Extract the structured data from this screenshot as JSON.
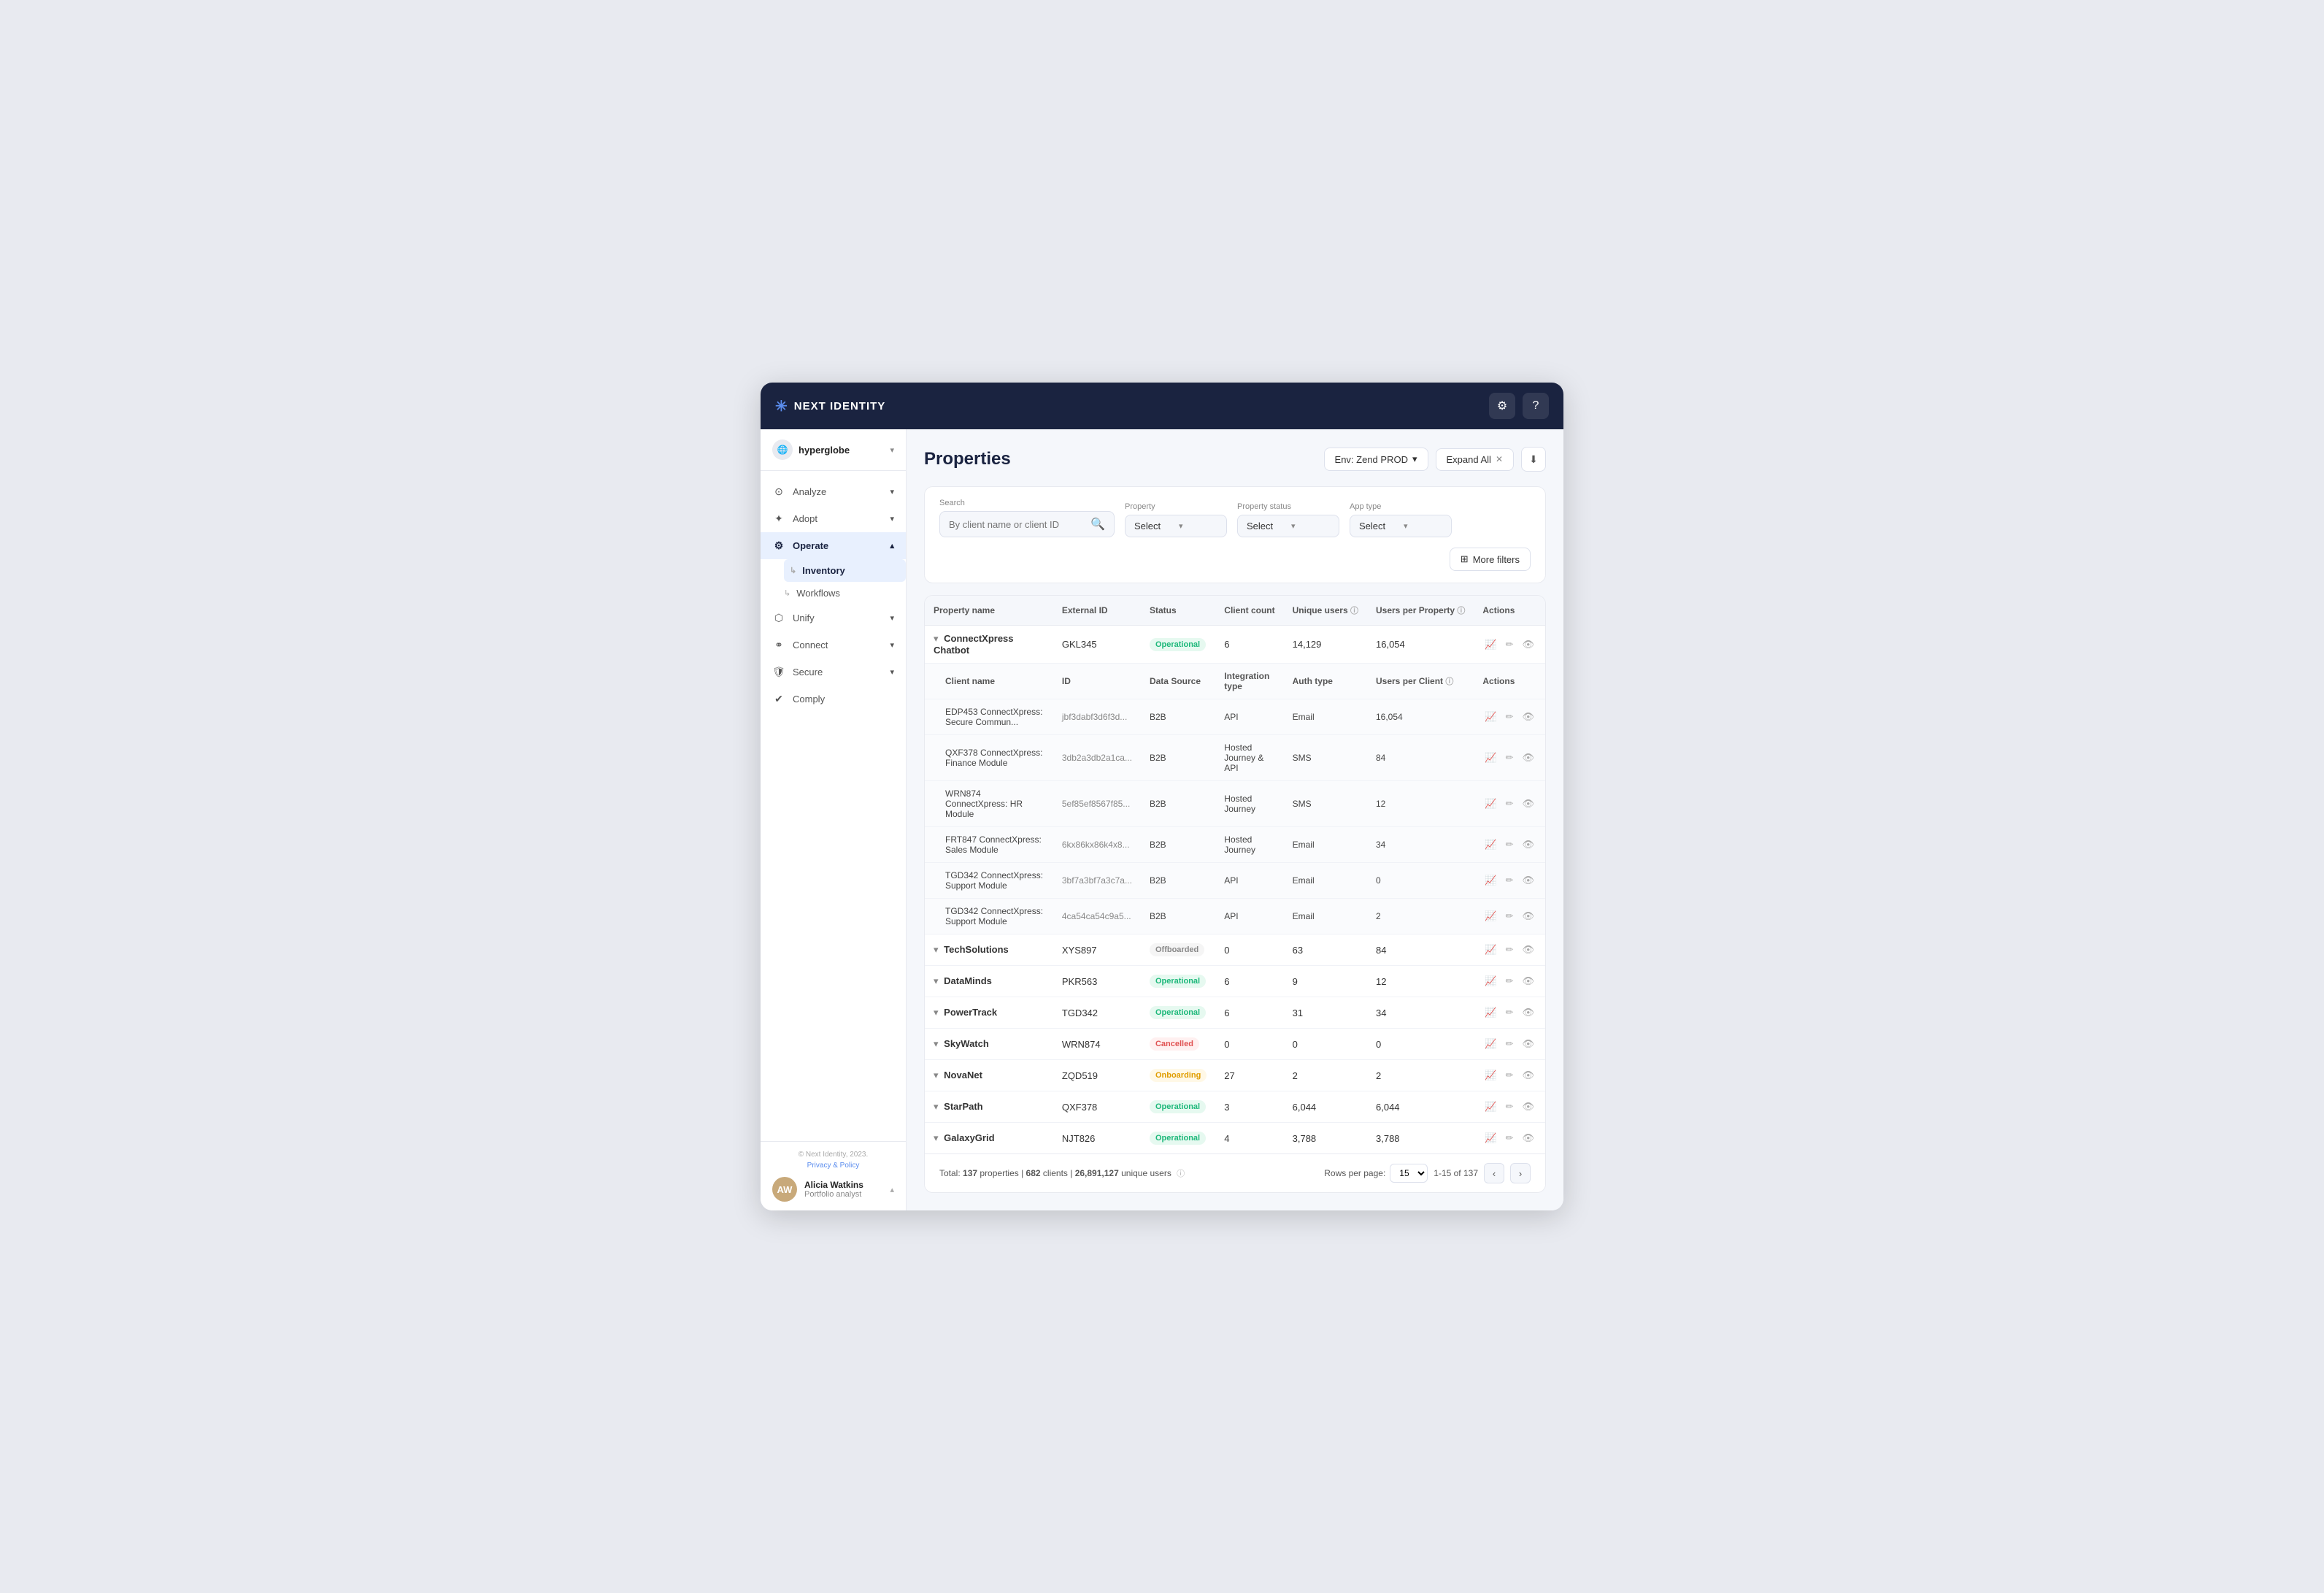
{
  "app": {
    "name": "NEXT IDENTITY",
    "logo_star": "✳"
  },
  "topbar": {
    "settings_label": "Settings",
    "help_label": "Help"
  },
  "sidebar": {
    "org_name": "hyperglobe",
    "nav_items": [
      {
        "id": "analyze",
        "label": "Analyze",
        "icon": "⊙",
        "has_arrow": true
      },
      {
        "id": "adopt",
        "label": "Adopt",
        "icon": "✦",
        "has_arrow": true
      },
      {
        "id": "operate",
        "label": "Operate",
        "icon": "⚙",
        "has_arrow": true,
        "active": true,
        "children": [
          {
            "id": "inventory",
            "label": "Inventory",
            "active": true
          },
          {
            "id": "workflows",
            "label": "Workflows"
          }
        ]
      },
      {
        "id": "unify",
        "label": "Unify",
        "icon": "⬡",
        "has_arrow": true
      },
      {
        "id": "connect",
        "label": "Connect",
        "icon": "⚭",
        "has_arrow": true
      },
      {
        "id": "secure",
        "label": "Secure",
        "icon": "⛨",
        "has_arrow": true
      },
      {
        "id": "comply",
        "label": "Comply",
        "icon": "✔",
        "has_arrow": false
      }
    ],
    "footer": {
      "copy": "© Next Identity, 2023.",
      "privacy": "Privacy & Policy"
    },
    "user": {
      "name": "Alicia Watkins",
      "role": "Portfolio analyst",
      "initials": "AW"
    }
  },
  "page": {
    "title": "Properties",
    "env_label": "Env: Zend PROD",
    "expand_label": "Expand All",
    "export_icon": "⬇"
  },
  "filters": {
    "search_label": "Search",
    "search_placeholder": "By client name or client ID",
    "property_label": "Property",
    "property_placeholder": "Select",
    "status_label": "Property status",
    "status_placeholder": "Select",
    "apptype_label": "App type",
    "apptype_placeholder": "Select",
    "more_filters_label": "More filters",
    "filter_icon": "⊞"
  },
  "table": {
    "headers": [
      {
        "id": "name",
        "label": "Property name"
      },
      {
        "id": "ext_id",
        "label": "External ID"
      },
      {
        "id": "status",
        "label": "Status"
      },
      {
        "id": "client_count",
        "label": "Client count"
      },
      {
        "id": "unique_users",
        "label": "Unique users"
      },
      {
        "id": "users_per_property",
        "label": "Users per Property"
      },
      {
        "id": "actions",
        "label": "Actions"
      }
    ],
    "sub_headers": [
      {
        "id": "client_name",
        "label": "Client name"
      },
      {
        "id": "id",
        "label": "ID"
      },
      {
        "id": "data_source",
        "label": "Data Source"
      },
      {
        "id": "integration_type",
        "label": "Integration type"
      },
      {
        "id": "auth_type",
        "label": "Auth type"
      },
      {
        "id": "users_per_client",
        "label": "Users per Client"
      },
      {
        "id": "sub_actions",
        "label": "Actions"
      }
    ],
    "rows": [
      {
        "id": "connectxpress",
        "name": "ConnectXpress Chatbot",
        "ext_id": "GKL345",
        "status": "Operational",
        "status_class": "status-operational",
        "client_count": "6",
        "unique_users": "14,129",
        "users_per_property": "16,054",
        "expanded": true,
        "children": [
          {
            "client_name": "EDP453 ConnectXpress: Secure Commun...",
            "id": "jbf3dabf3d6f3d...",
            "data_source": "B2B",
            "integration_type": "API",
            "auth_type": "Email",
            "users_per_client": "16,054"
          },
          {
            "client_name": "QXF378 ConnectXpress: Finance Module",
            "id": "3db2a3db2a1ca...",
            "data_source": "B2B",
            "integration_type": "Hosted Journey & API",
            "auth_type": "SMS",
            "users_per_client": "84"
          },
          {
            "client_name": "WRN874 ConnectXpress: HR Module",
            "id": "5ef85ef8567f85...",
            "data_source": "B2B",
            "integration_type": "Hosted Journey",
            "auth_type": "SMS",
            "users_per_client": "12"
          },
          {
            "client_name": "FRT847 ConnectXpress: Sales Module",
            "id": "6kx86kx86k4x8...",
            "data_source": "B2B",
            "integration_type": "Hosted Journey",
            "auth_type": "Email",
            "users_per_client": "34"
          },
          {
            "client_name": "TGD342 ConnectXpress: Support Module",
            "id": "3bf7a3bf7a3c7a...",
            "data_source": "B2B",
            "integration_type": "API",
            "auth_type": "Email",
            "users_per_client": "0"
          },
          {
            "client_name": "TGD342 ConnectXpress: Support Module",
            "id": "4ca54ca54c9a5...",
            "data_source": "B2B",
            "integration_type": "API",
            "auth_type": "Email",
            "users_per_client": "2"
          }
        ]
      },
      {
        "id": "techsolutions",
        "name": "TechSolutions",
        "ext_id": "XYS897",
        "status": "Offboarded",
        "status_class": "status-offboarded",
        "client_count": "0",
        "unique_users": "63",
        "users_per_property": "84",
        "expanded": false
      },
      {
        "id": "dataminds",
        "name": "DataMinds",
        "ext_id": "PKR563",
        "status": "Operational",
        "status_class": "status-operational",
        "client_count": "6",
        "unique_users": "9",
        "users_per_property": "12",
        "expanded": false
      },
      {
        "id": "powertrack",
        "name": "PowerTrack",
        "ext_id": "TGD342",
        "status": "Operational",
        "status_class": "status-operational",
        "client_count": "6",
        "unique_users": "31",
        "users_per_property": "34",
        "expanded": false
      },
      {
        "id": "skywatch",
        "name": "SkyWatch",
        "ext_id": "WRN874",
        "status": "Cancelled",
        "status_class": "status-cancelled",
        "client_count": "0",
        "unique_users": "0",
        "users_per_property": "0",
        "expanded": false
      },
      {
        "id": "novanet",
        "name": "NovaNet",
        "ext_id": "ZQD519",
        "status": "Onboarding",
        "status_class": "status-onboarding",
        "client_count": "27",
        "unique_users": "2",
        "users_per_property": "2",
        "expanded": false
      },
      {
        "id": "starpath",
        "name": "StarPath",
        "ext_id": "QXF378",
        "status": "Operational",
        "status_class": "status-operational",
        "client_count": "3",
        "unique_users": "6,044",
        "users_per_property": "6,044",
        "expanded": false
      },
      {
        "id": "galaxygrid",
        "name": "GalaxyGrid",
        "ext_id": "NJT826",
        "status": "Operational",
        "status_class": "status-operational",
        "client_count": "4",
        "unique_users": "3,788",
        "users_per_property": "3,788",
        "expanded": false
      }
    ]
  },
  "table_footer": {
    "total_properties": "137",
    "total_clients": "682",
    "total_unique_users": "26,891,127",
    "rows_per_page_label": "Rows per page:",
    "rows_per_page_value": "15",
    "page_range": "1-15 of 137"
  }
}
